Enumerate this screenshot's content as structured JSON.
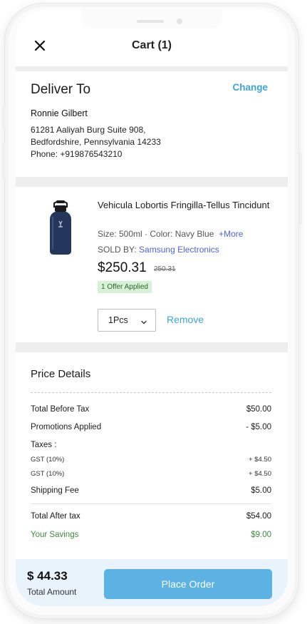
{
  "header": {
    "title": "Cart (1)",
    "close_icon": "close-icon"
  },
  "deliver": {
    "heading": "Deliver To",
    "change_label": "Change",
    "name": "Ronnie Gilbert",
    "address_line1": "61281 Aaliyah Burg Suite 908,",
    "address_line2": "Bedfordshire, Pennsylvania 14233",
    "phone": "Phone: +919876543210"
  },
  "item": {
    "image_icon": "water-bottle-image",
    "name": "Vehicula Lobortis Fringilla-Tellus Tincidunt",
    "meta": "Size: 500ml · Color: Navy Blue",
    "more_label": "+More",
    "sold_by_label": "SOLD BY:",
    "seller": "Samsung Electronics",
    "price": "$250.31",
    "old_price": "250.31",
    "offer": "1 Offer Applied",
    "quantity": "1Pcs",
    "remove_label": "Remove"
  },
  "price_details": {
    "heading": "Price Details",
    "rows": [
      {
        "label": "Total Before Tax",
        "value": "$50.00"
      },
      {
        "label": "Promotions Applied",
        "value": "- $5.00"
      },
      {
        "label": "Taxes :",
        "value": ""
      },
      {
        "label": "GST (10%)",
        "value": "+ $4.50"
      },
      {
        "label": "GST (10%)",
        "value": "+ $4.50"
      },
      {
        "label": "Shipping Fee",
        "value": "$5.00"
      },
      {
        "label": "Total After tax",
        "value": "$54.00"
      },
      {
        "label": "Your Savings",
        "value": "$9.00"
      }
    ]
  },
  "footer": {
    "total_amount": "$ 44.33",
    "total_label": "Total Amount",
    "place_order_label": "Place Order"
  },
  "colors": {
    "accent": "#3ba6d8",
    "button": "#5cb2e3",
    "link": "#4d63d9",
    "savings": "#3d8a3d",
    "offer_bg": "#d8efd8",
    "footer_bg": "#e8f3fb"
  }
}
